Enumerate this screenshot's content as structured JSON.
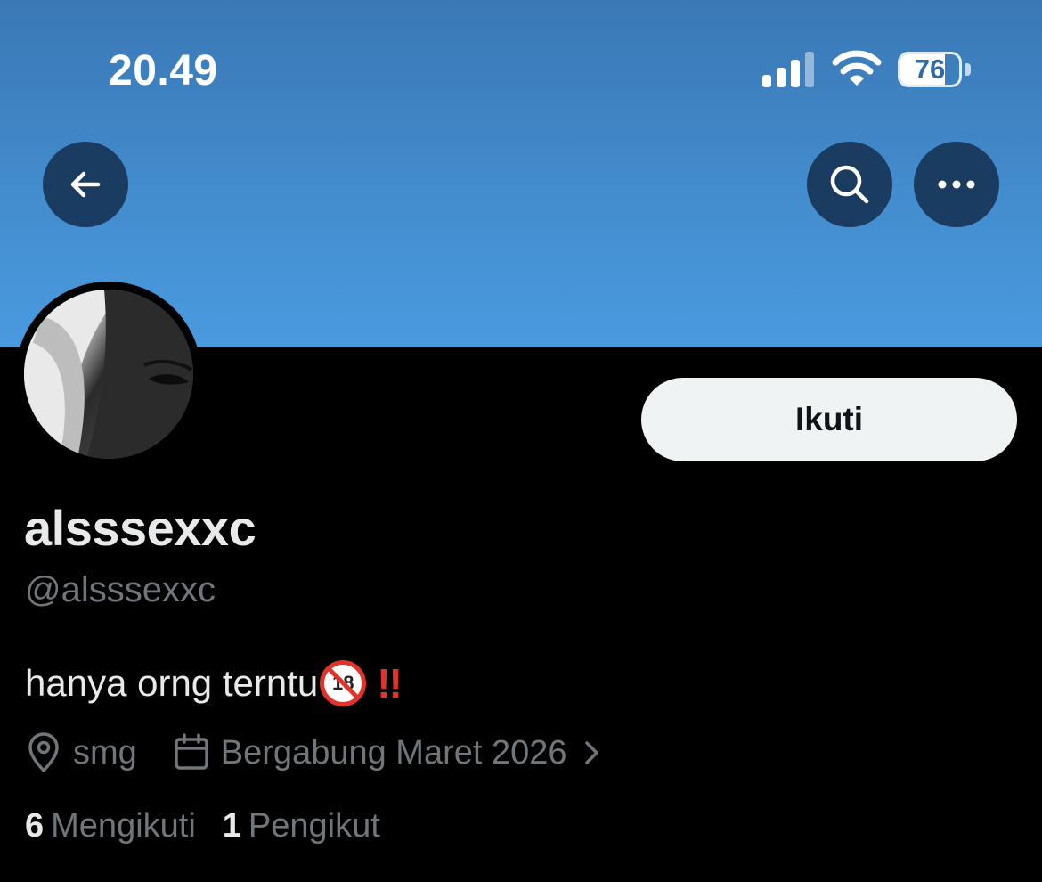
{
  "status_bar": {
    "time": "20.49",
    "battery_percent": "76",
    "battery_level": 0.76
  },
  "nav": {
    "back_icon": "arrow-left-icon",
    "search_icon": "search-icon",
    "more_icon": "more-horizontal-icon"
  },
  "colors": {
    "banner_top": "#3a78b5",
    "banner_bottom": "#4a9ae0",
    "background": "#000000",
    "follow_button_bg": "#eff3f4",
    "secondary_text": "#71767b",
    "alert_red": "#e0332b"
  },
  "profile": {
    "display_name": "alsssexxc",
    "handle": "@alsssexxc",
    "bio_text": "hanya orng terntu",
    "bio_emoji_no_under_18": "🔞",
    "bio_emoji_no18_number": "18",
    "bio_emoji_bangs": "‼️",
    "follow_label": "Ikuti",
    "location": "smg",
    "location_icon": "location-pin-icon",
    "joined": "Bergabung Maret 2026",
    "joined_icon": "calendar-icon",
    "following_count": "6",
    "following_label": "Mengikuti",
    "followers_count": "1",
    "followers_label": "Pengikut"
  }
}
